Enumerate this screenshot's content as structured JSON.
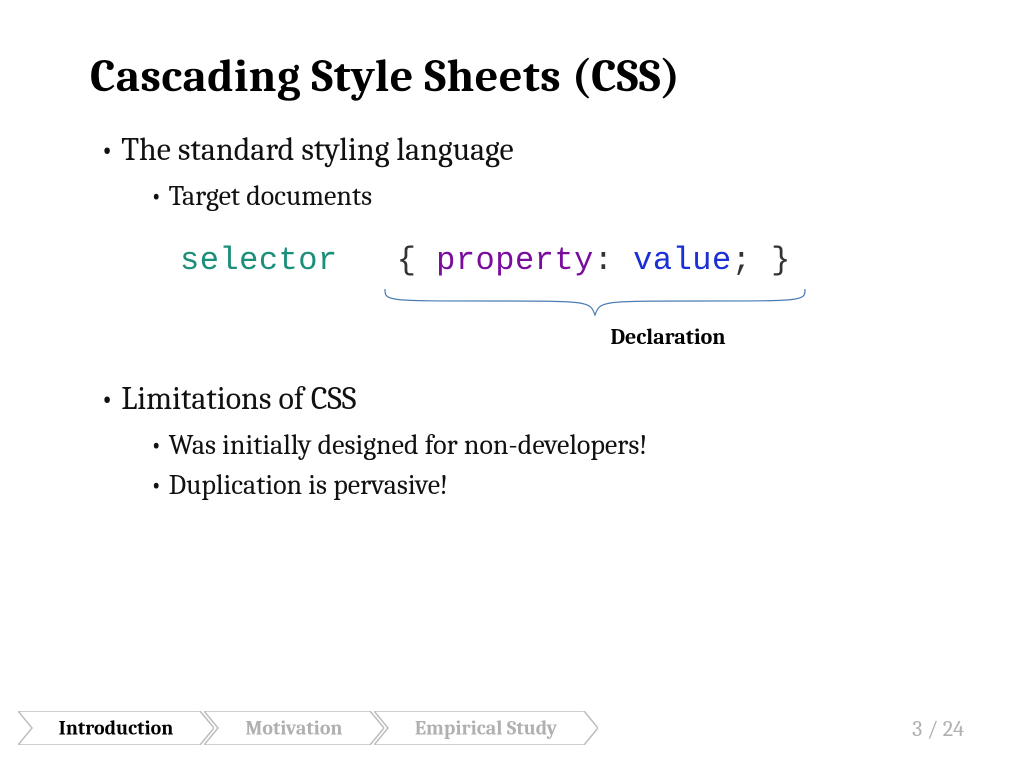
{
  "title": "Cascading Style Sheets (CSS)",
  "bullets": {
    "b1": "The standard styling language",
    "b1a": "Target documents",
    "b2": "Limitations of CSS",
    "b2a": "Was initially designed for non-developers!",
    "b2b": "Duplication is pervasive!"
  },
  "code": {
    "selector": "selector",
    "open": "{",
    "property": "property",
    "colon": ":",
    "value": "value",
    "semi": ";",
    "close": "}"
  },
  "annotation": {
    "declaration": "Declaration"
  },
  "nav": {
    "s1": "Introduction",
    "s2": "Motivation",
    "s3": "Empirical Study"
  },
  "pager": {
    "current": "3",
    "sep": " / ",
    "total": "24"
  }
}
